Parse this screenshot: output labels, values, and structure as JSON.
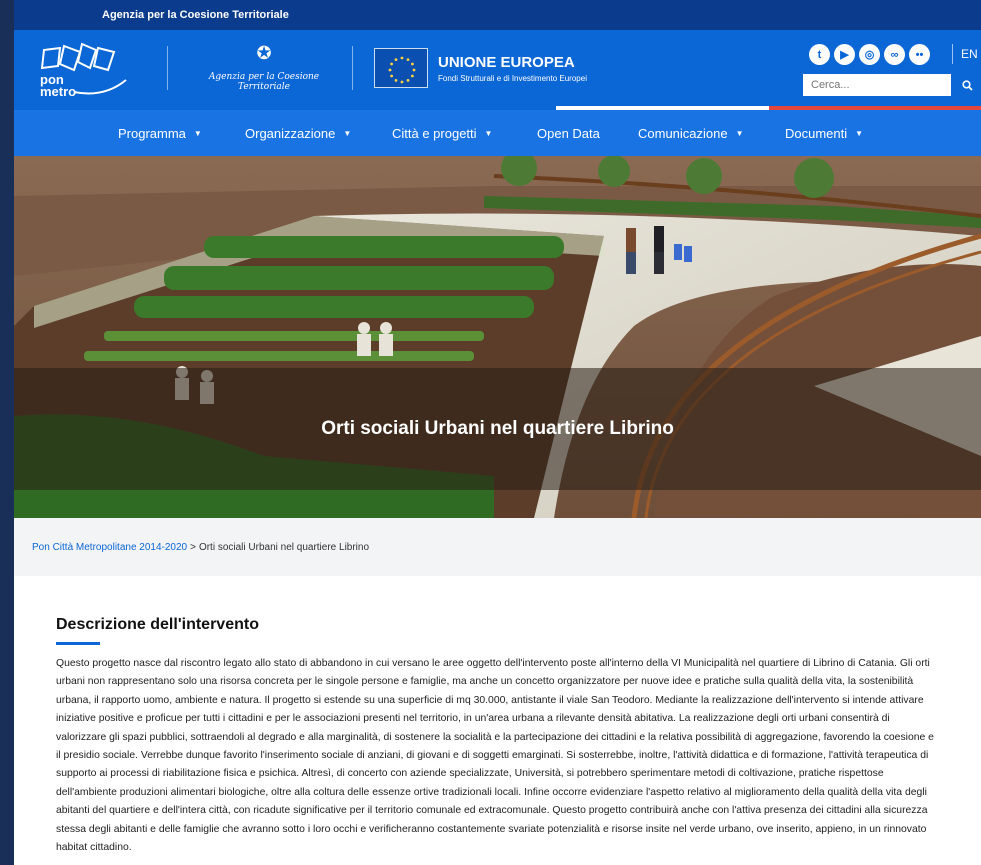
{
  "topbar": {
    "agency_label": "Agenzia per la Coesione Territoriale"
  },
  "header": {
    "pon_logo_text": [
      "pon",
      "metro"
    ],
    "agenzia_script": "Agenzia per la Coesione Territoriale",
    "eu_title": "UNIONE EUROPEA",
    "eu_subtitle": "Fondi Strutturali e di Investimento Europei",
    "socials": [
      "twitter-icon",
      "youtube-icon",
      "instagram-icon",
      "tripadvisor-icon",
      "flickr-icon"
    ],
    "lang": "EN",
    "search_placeholder": "Cerca...",
    "tricolor": [
      "#ffffff",
      "#ffffff",
      "#e2463d"
    ]
  },
  "nav": {
    "items": [
      {
        "label": "Programma",
        "has_menu": true
      },
      {
        "label": "Organizzazione",
        "has_menu": true
      },
      {
        "label": "Città e progetti",
        "has_menu": true
      },
      {
        "label": "Open Data",
        "has_menu": false
      },
      {
        "label": "Comunicazione",
        "has_menu": true
      },
      {
        "label": "Documenti",
        "has_menu": true
      }
    ],
    "caret": "▼"
  },
  "hero": {
    "title": "Orti sociali Urbani nel quartiere Librino"
  },
  "breadcrumb": {
    "home": "Pon Città Metropolitane 2014-2020",
    "separator": ">",
    "current": "Orti sociali Urbani nel quartiere Librino"
  },
  "content": {
    "heading": "Descrizione dell'intervento",
    "body": "Questo progetto nasce dal riscontro legato allo stato di abbandono in cui versano le aree oggetto dell'intervento poste all'interno della VI Municipalità nel quartiere di Librino di Catania. Gli orti urbani non rappresentano solo una risorsa concreta per le singole persone e famiglie, ma anche un concetto organizzatore per nuove idee e pratiche sulla qualità della vita, la sostenibilità urbana, il rapporto uomo, ambiente e natura. Il progetto si estende su una superficie di mq 30.000, antistante il viale San Teodoro. Mediante la realizzazione dell'intervento si intende attivare iniziative positive e proficue per tutti i cittadini e per le associazioni presenti nel territorio, in un'area urbana a rilevante densità abitativa. La realizzazione degli orti urbani consentirà di valorizzare gli spazi pubblici, sottraendoli al degrado e alla marginalità, di sostenere la socialità e la partecipazione dei cittadini e la relativa possibilità di aggregazione, favorendo la coesione e il presidio sociale. Verrebbe dunque favorito l'inserimento sociale di anziani, di giovani e di soggetti emarginati. Si sosterrebbe, inoltre, l'attività didattica e di formazione, l'attività terapeutica di supporto ai processi di riabilitazione fisica e psichica. Altresì, di concerto con aziende specializzate, Università, si potrebbero sperimentare metodi di coltivazione, pratiche rispettose dell'ambiente produzioni alimentari biologiche, oltre alla coltura delle essenze ortive tradizionali locali. Infine occorre evidenziare l'aspetto relativo al miglioramento della qualità della vita degli abitanti del quartiere e dell'intera città, con ricadute significative per il territorio comunale ed extracomunale. Questo progetto contribuirà anche con l'attiva presenza dei cittadini alla sicurezza stessa degli abitanti e delle famiglie che avranno sotto i loro occhi e verificheranno costantemente svariate potenzialità e risorse insite nel verde urbano, ove inserito, appieno, in un rinnovato habitat cittadino."
  }
}
